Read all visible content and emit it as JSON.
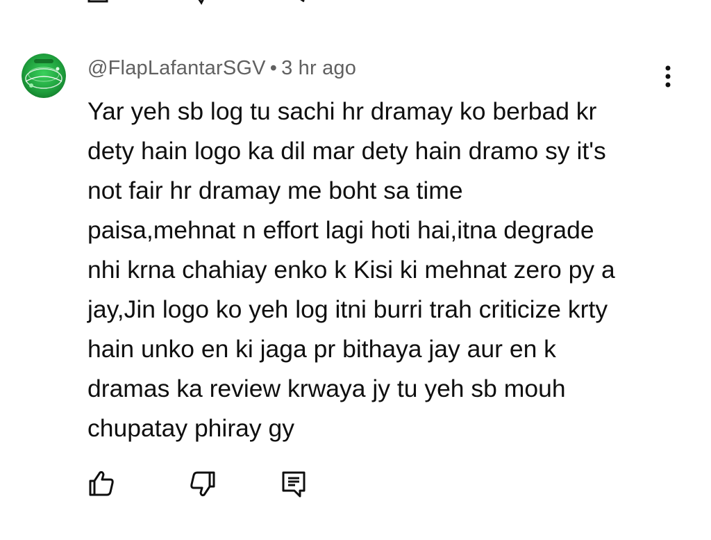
{
  "comment": {
    "author": "@FlapLafantarSGV",
    "separator": "•",
    "time": "3 hr ago",
    "text_lines": [
      "Yar yeh sb log tu sachi hr dramay ko berbad kr",
      "dety hain logo ka dil mar dety hain dramo sy it's",
      "not fair hr dramay me boht sa time",
      "paisa,mehnat n effort lagi hoti hai,itna degrade",
      "nhi krna chahiay enko k Kisi ki mehnat zero py a",
      "jay,Jin logo ko yeh log itni burri trah criticize krty",
      "hain unko en ki jaga pr bithaya jay aur en k",
      "dramas ka review krwaya jy tu yeh sb mouh",
      "chupatay phiray gy"
    ],
    "icons": {
      "avatar": "green-circular-avatar",
      "menu": "vertical-ellipsis-icon",
      "like": "thumbs-up-icon",
      "dislike": "thumbs-down-icon",
      "reply": "reply-comment-icon"
    }
  },
  "colors": {
    "text": "#0f0f0f",
    "meta": "#606060",
    "icon": "#0f0f0f",
    "avatar_green": "#22b14c"
  }
}
